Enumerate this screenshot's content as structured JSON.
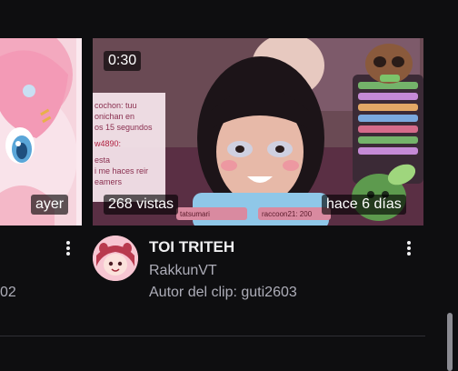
{
  "left_card": {
    "time_badge": "ayer",
    "partial_meta": "02"
  },
  "right_card": {
    "duration": "0:30",
    "views": "268 vistas",
    "age": "hace 6 días",
    "title": "TOI TRITEH",
    "channel": "RakkunVT",
    "clipper": "Autor del clip: guti2603",
    "stream_overlay": {
      "chat_lines": [
        "cochon: tuu",
        "onichan en",
        "os 15 segundos",
        "w4890:",
        "esta",
        "i me haces reir",
        "eamers"
      ],
      "alert_bar_left": "tatsumari",
      "alert_bar_right": "raccoon21: 200"
    }
  },
  "colors": {
    "background": "#0e0e10",
    "text_primary": "#efeff1",
    "text_secondary": "#adadb8",
    "badge_bg": "rgba(0,0,0,0.62)"
  },
  "icons": {
    "more": "kebab-menu-icon",
    "avatar": "channel-avatar"
  }
}
